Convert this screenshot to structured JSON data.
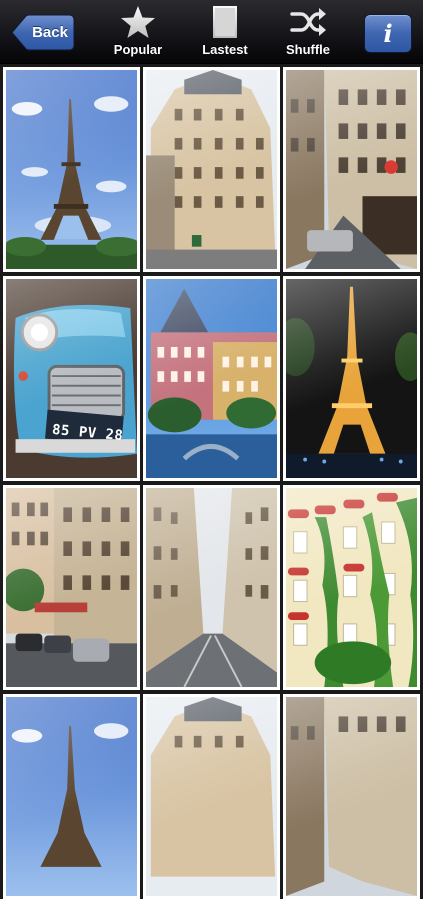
{
  "toolbar": {
    "back_label": "Back",
    "tabs": [
      {
        "label": "Popular",
        "icon": "star-icon"
      },
      {
        "label": "Lastest",
        "icon": "page-icon"
      },
      {
        "label": "Shuffle",
        "icon": "shuffle-icon"
      }
    ],
    "info_label": "i"
  },
  "photos": [
    {
      "subject": "eiffel-tower-day"
    },
    {
      "subject": "haussmann-building"
    },
    {
      "subject": "paris-street"
    },
    {
      "subject": "blue-citroen-2cv",
      "plate": "85 PV 28"
    },
    {
      "subject": "pink-chateau"
    },
    {
      "subject": "eiffel-tower-night"
    },
    {
      "subject": "paris-street-cars"
    },
    {
      "subject": "narrow-street"
    },
    {
      "subject": "ivy-building"
    },
    {
      "subject": "eiffel-tower-day"
    },
    {
      "subject": "haussmann-building"
    },
    {
      "subject": "paris-street"
    }
  ],
  "colors": {
    "accent": "#3f66b0",
    "toolbar": "#15151a"
  }
}
